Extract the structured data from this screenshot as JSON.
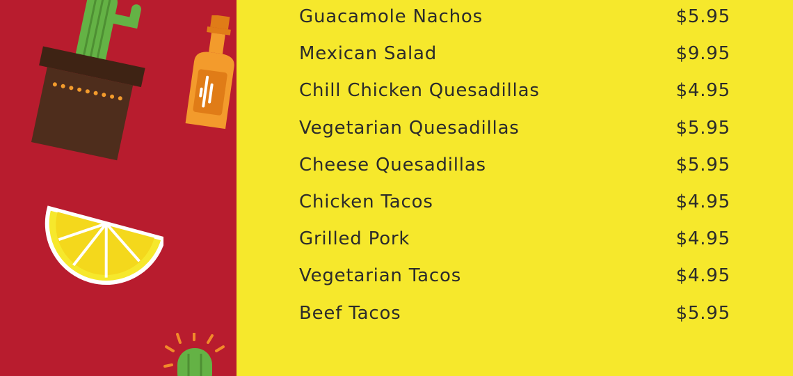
{
  "colors": {
    "left_background": "#b81c2e",
    "menu_background": "#f6e82c",
    "text": "#2b2b2b",
    "cactus_green": "#64b245",
    "pot_brown": "#4e2d1c",
    "bottle_orange": "#f39b2c",
    "lemon_yellow": "#f6e82c",
    "sun_orange": "#f28a2a"
  },
  "decorations": [
    "potted-cactus-icon",
    "bottle-icon",
    "lemon-slice-icon",
    "small-cactus-icon"
  ],
  "menu": {
    "items": [
      {
        "name": "Guacamole Nachos",
        "price": "$5.95"
      },
      {
        "name": "Mexican Salad",
        "price": "$9.95"
      },
      {
        "name": "Chill Chicken Quesadillas",
        "price": "$4.95"
      },
      {
        "name": "Vegetarian Quesadillas",
        "price": "$5.95"
      },
      {
        "name": "Cheese Quesadillas",
        "price": "$5.95"
      },
      {
        "name": "Chicken Tacos",
        "price": "$4.95"
      },
      {
        "name": "Grilled Pork",
        "price": "$4.95"
      },
      {
        "name": "Vegetarian Tacos",
        "price": "$4.95"
      },
      {
        "name": "Beef Tacos",
        "price": "$5.95"
      }
    ]
  }
}
